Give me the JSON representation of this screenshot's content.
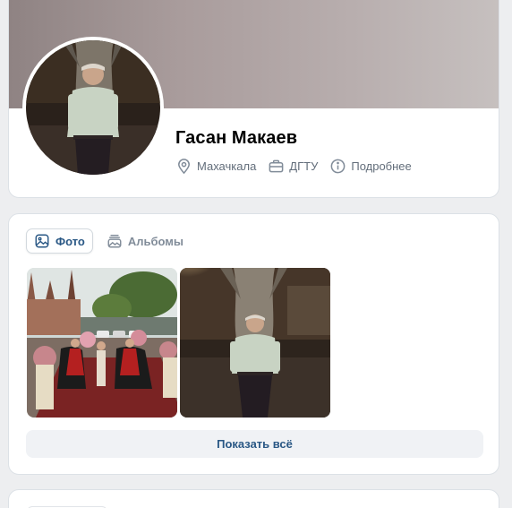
{
  "profile": {
    "name": "Гасан Макаев",
    "meta": [
      {
        "icon": "location-pin-icon",
        "label": "Махачкала"
      },
      {
        "icon": "briefcase-icon",
        "label": "ДГТУ"
      },
      {
        "icon": "info-icon",
        "label": "Подробнее"
      }
    ]
  },
  "photos": {
    "tabs": [
      {
        "icon": "image-icon",
        "label": "Фото",
        "active": true
      },
      {
        "icon": "albums-icon",
        "label": "Альбомы",
        "active": false
      }
    ],
    "show_all_label": "Показать всё"
  },
  "colors": {
    "page_bg": "#edeef0",
    "card_bg": "#ffffff",
    "link_blue": "#2a5885",
    "muted_text": "#626d7a"
  }
}
